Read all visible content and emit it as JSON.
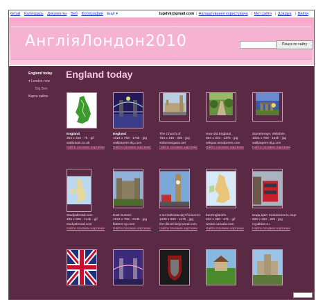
{
  "gbar": {
    "links": [
      "Gmail",
      "Календарь",
      "Документы",
      "Веб",
      "Фотографии",
      "Ещё ▾"
    ],
    "email": "tupdvk@gmail.com",
    "right_links": [
      "Налаштування користувача",
      "Мої сайти",
      "Довідка",
      "Вийти"
    ]
  },
  "site": {
    "title": "АнгліяЛондон2010",
    "search_placeholder": "",
    "search_button": "Пошук по сайту"
  },
  "sidebar": {
    "current": "England today",
    "items": [
      "London now",
      "Big Ben",
      "Карта сайта"
    ]
  },
  "page": {
    "title": "England today"
  },
  "images": [
    {
      "title": "England",
      "size": "304 x 202 - 7k - gif",
      "domain": "watbritain.co.uk",
      "similar": "Найти похожие картинки"
    },
    {
      "title": "England",
      "size": "1024 x 768 - 176k - jpg",
      "domain": "wallpapers-dig.com",
      "similar": "Найти похожие картинки"
    },
    {
      "title": "The Church of",
      "size": "783 x 446 - 35k - jpg",
      "domain": "solarnavigator.net",
      "similar": "Найти похожие картинки"
    },
    {
      "title": "How did England",
      "size": "594 x 333 - 137k - jpg",
      "domain": "askpan.wordpress.com",
      "similar": "Найти похожие картинки"
    },
    {
      "title": "Stonehenge, Wiltshire,",
      "size": "1024 x 768 - 164k - jpg",
      "domain": "wallpapers-dig.com",
      "similar": "Найти похожие картинки"
    },
    {
      "title": "Studyabroad.com",
      "size": "405 x 650 - 114k - gif",
      "domain": "studyabroad.com",
      "similar": "Найти похожие картинки"
    },
    {
      "title": "East Sussex",
      "size": "1024 x 768 - 213k - jpg",
      "domain": "flatters-vp.com",
      "similar": "Найти похожие картинки"
    },
    {
      "title": "к английским футбольного",
      "size": "1200 x 900 - 147k - jpg",
      "domain": "the-dizzel.livejournal.com",
      "similar": "Найти похожие картинки"
    },
    {
      "title": "but England's",
      "size": "400 x 380 - 67k - gif",
      "domain": "www2.canada.com",
      "similar": "Найти похожие картинки"
    },
    {
      "title": "мода дает возможность еще",
      "size": "600 x 450 - 62k - jpg",
      "domain": "myalbion.ru",
      "similar": "Найти похожие картинки"
    },
    {
      "title": "",
      "size": "",
      "domain": "",
      "similar": ""
    },
    {
      "title": "",
      "size": "",
      "domain": "",
      "similar": ""
    },
    {
      "title": "",
      "size": "",
      "domain": "",
      "similar": ""
    },
    {
      "title": "",
      "size": "",
      "domain": "",
      "similar": ""
    },
    {
      "title": "",
      "size": "",
      "domain": "",
      "similar": ""
    }
  ],
  "colors": {
    "banner": "#f6b3d1",
    "content_bg": "#5a2944",
    "link_pink": "#f49ac4"
  }
}
